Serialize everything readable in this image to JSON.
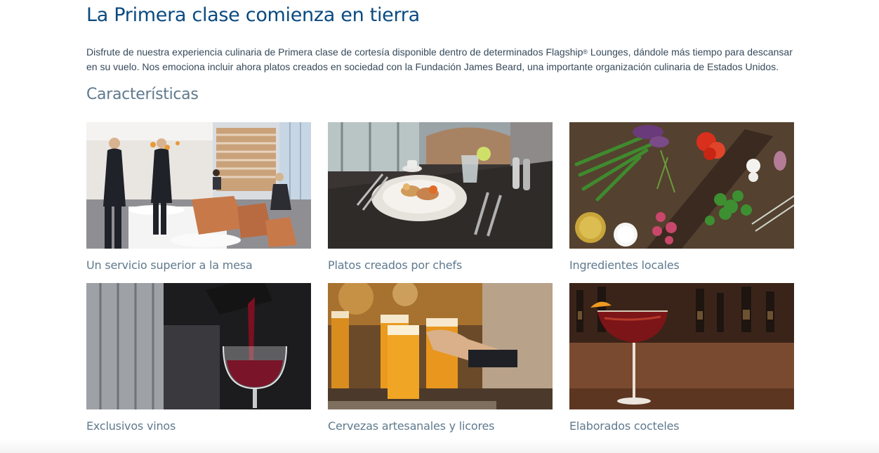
{
  "header": {
    "title": "La Primera clase comienza en tierra"
  },
  "intro": {
    "text_before": "Disfrute de nuestra experiencia culinaria de Primera clase de cortesía disponible dentro de determinados Flagship",
    "registered_mark": "®",
    "text_after": " Lounges, dándole más tiempo para descansar en su vuelo. Nos emociona incluir ahora platos creados en sociedad con la Fundación James Beard, una importante organización culinaria de Estados Unidos."
  },
  "features": {
    "title": "Características",
    "items": [
      {
        "label": "Un servicio superior a la mesa",
        "image": "lounge-dining-room-photo"
      },
      {
        "label": "Platos creados por chefs",
        "image": "plated-dish-photo"
      },
      {
        "label": "Ingredientes locales",
        "image": "fresh-ingredients-photo"
      },
      {
        "label": "Exclusivos vinos",
        "image": "red-wine-pour-photo"
      },
      {
        "label": "Cervezas artesanales y licores",
        "image": "craft-beer-photo"
      },
      {
        "label": "Elaborados cocteles",
        "image": "cocktail-photo"
      }
    ]
  },
  "colors": {
    "title": "#0a4a80",
    "body_text": "#36495a",
    "subtitle": "#5f7a8e"
  }
}
